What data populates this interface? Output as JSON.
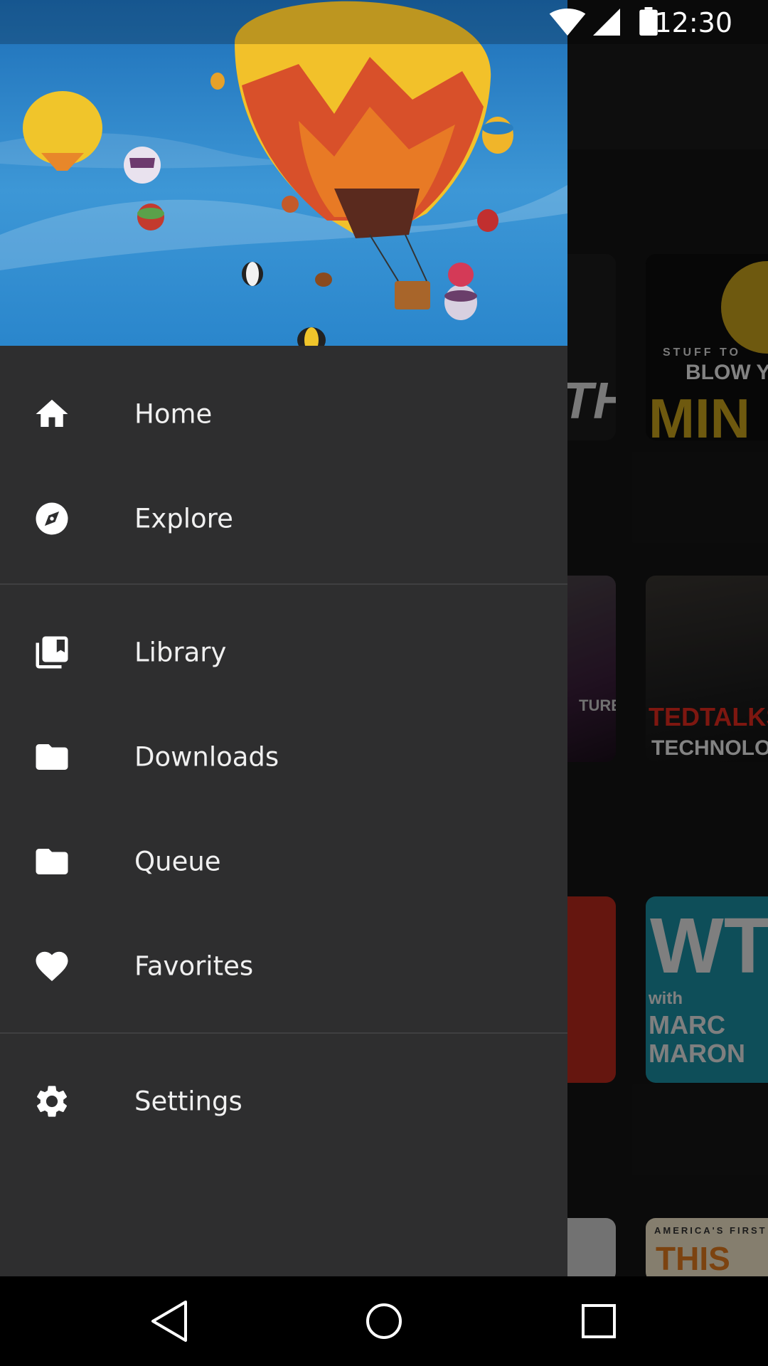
{
  "status_bar": {
    "time": "12:30",
    "icons": [
      "wifi-icon",
      "cellular-signal-icon",
      "battery-icon"
    ]
  },
  "background": {
    "cards": [
      {
        "text": [
          "TH"
        ]
      },
      {
        "text": [
          "STUFF TO",
          "BLOW Y",
          "MIN"
        ]
      },
      {
        "text": [
          "TURE"
        ]
      },
      {
        "text": [
          "TEDTALKS",
          "TECHNOLO"
        ]
      },
      {
        "text": []
      },
      {
        "text": [
          "WT",
          "with",
          "MARC",
          "MARON"
        ]
      },
      {
        "text": []
      },
      {
        "text": [
          "AMERICA'S FIRST",
          "THIS"
        ]
      }
    ]
  },
  "drawer": {
    "header_image": "hot-air-balloons",
    "items": [
      {
        "label": "Home",
        "icon": "home-icon"
      },
      {
        "label": "Explore",
        "icon": "compass-icon"
      },
      {
        "label": "Library",
        "icon": "library-icon"
      },
      {
        "label": "Downloads",
        "icon": "folder-icon"
      },
      {
        "label": "Queue",
        "icon": "folder-icon"
      },
      {
        "label": "Favorites",
        "icon": "heart-icon"
      },
      {
        "label": "Settings",
        "icon": "gear-icon"
      }
    ]
  },
  "nav_bar": {
    "buttons": [
      "back-icon",
      "home-circle-icon",
      "recents-icon"
    ]
  },
  "colors": {
    "drawer_bg": "#2e2e2f",
    "text": "#f0f0f0",
    "sky": "#2f8fd3",
    "balloon_yellow": "#f2c12a"
  }
}
